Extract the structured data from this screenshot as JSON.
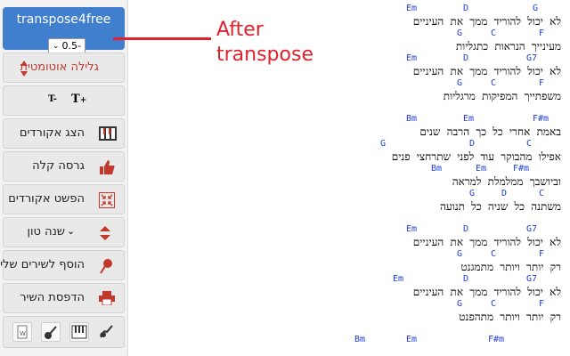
{
  "sidebar": {
    "brand": "transpose4free",
    "semitone_value": "0.5-",
    "buttons": {
      "autoscroll": "גלילה אוטומטית",
      "text_smaller": "T",
      "text_larger": "T",
      "show_chords": "הצג אקורדים",
      "easy_version": "גרסה קלה",
      "simplify_chords": "הפשט אקורדים",
      "change_key": "שנה טון",
      "add_to_my_songs": "הוסף לשירים שלי",
      "print_song": "הדפסת השיר"
    },
    "colors": {
      "brand": "#3f7fce",
      "autoscroll_text": "#c0392b",
      "icon_red": "#c0392b"
    }
  },
  "annotation": {
    "line1": "After",
    "line2": "transpose",
    "color": "#e2202a"
  },
  "song": {
    "chord_color": "#1f3fd6",
    "stanzas": [
      [
        {
          "chords": [
            "Em",
            "D",
            "G"
          ],
          "lyric": "לא יכול להוריד ממך את העיניים"
        },
        {
          "chords": [
            "G",
            "C",
            "F"
          ],
          "lyric": "מעינייך הנראות כתגליות"
        },
        {
          "chords": [
            "Em",
            "D",
            "G7"
          ],
          "lyric": "לא יכול להוריד ממך את העיניים"
        },
        {
          "chords": [
            "G",
            "C",
            "F"
          ],
          "lyric": "משפתייך המפיקות מרגליות"
        }
      ],
      [
        {
          "chords": [
            "Bm",
            "Em",
            "F#m"
          ],
          "lyric": "באמת אחרי כל כך הרבה שנים"
        },
        {
          "chords": [
            "G",
            "D",
            "C"
          ],
          "lyric": "אפילו מהבוקר עוד לפני שתרחצי פנים"
        },
        {
          "chords": [
            "Bm",
            "Em",
            "F#m"
          ],
          "lyric": "וביושבך ממלמלת למראה"
        },
        {
          "chords": [
            "G",
            "D",
            "C"
          ],
          "lyric": "משתנה כל שניה כל תנועה"
        }
      ],
      [
        {
          "chords": [
            "Em",
            "D",
            "G7"
          ],
          "lyric": "לא יכול להוריד ממך את העיניים"
        },
        {
          "chords": [
            "G",
            "C",
            "F"
          ],
          "lyric": "רק יותר ויותר מתמגנט"
        },
        {
          "chords": [
            "Em",
            "D",
            "G7"
          ],
          "lyric": "לא יכול להוריד ממך את העיניים"
        },
        {
          "chords": [
            "G",
            "C",
            "F"
          ],
          "lyric": "רק יותר ויותר מתהפנט"
        }
      ],
      [
        {
          "chords": [
            "Bm",
            "Em",
            "F#m"
          ],
          "lyric": ""
        }
      ]
    ]
  }
}
